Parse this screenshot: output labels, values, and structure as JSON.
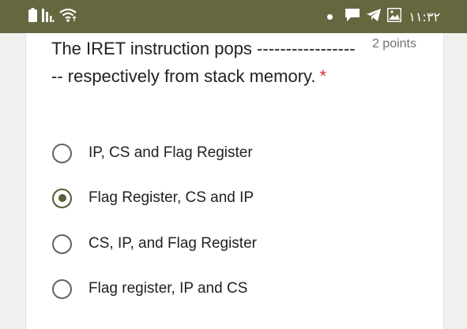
{
  "status_bar": {
    "time": "١١:٣٢",
    "icons": [
      "battery-icon",
      "signal-icon",
      "wifi-icon",
      "notification-dot-icon",
      "chat-icon",
      "telegram-icon",
      "image-icon"
    ]
  },
  "question": {
    "text": "The IRET instruction pops ------------------- respectively from stack memory.",
    "required_marker": "*",
    "points": "2 points"
  },
  "options": [
    {
      "label": "IP, CS and Flag Register",
      "selected": false
    },
    {
      "label": "Flag Register, CS and IP",
      "selected": true
    },
    {
      "label": "CS, IP, and Flag Register",
      "selected": false
    },
    {
      "label": "Flag register, IP and CS",
      "selected": false
    }
  ],
  "colors": {
    "status_bar": "#65673f",
    "accent": "#5a5c38",
    "required": "#d93025"
  }
}
